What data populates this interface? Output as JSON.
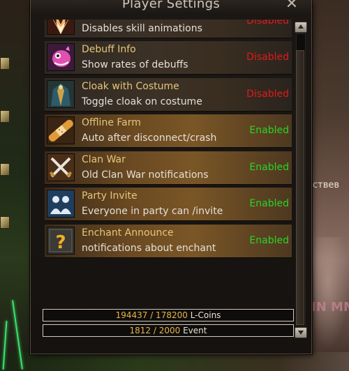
{
  "window": {
    "title": "Player Settings",
    "close_glyph": "✕"
  },
  "settings": [
    {
      "name": "",
      "desc": "Disables skill animations",
      "status": "Disabled",
      "state": "off",
      "icon": "burst-icon"
    },
    {
      "name": "Debuff Info",
      "desc": "Show rates of debuffs",
      "status": "Disabled",
      "state": "off",
      "icon": "pink-creature-icon"
    },
    {
      "name": "Cloak with Costume",
      "desc": "Toggle cloak on costume",
      "status": "Disabled",
      "state": "off",
      "icon": "cloak-icon"
    },
    {
      "name": "Offline Farm",
      "desc": "Auto after disconnect/crash",
      "status": "Enabled",
      "state": "on",
      "icon": "bandage-icon"
    },
    {
      "name": "Clan War",
      "desc": "Old Clan War notifications",
      "status": "Enabled",
      "state": "on",
      "icon": "crossed-swords-icon"
    },
    {
      "name": "Party Invite",
      "desc": "Everyone in party can /invite",
      "status": "Enabled",
      "state": "on",
      "icon": "party-people-icon"
    },
    {
      "name": "Enchant Announce",
      "desc": "notifications about enchant",
      "status": "Enabled",
      "state": "on",
      "icon": "question-mark-icon"
    }
  ],
  "counters": {
    "lcoins": {
      "value": "194437 / 178200",
      "unit": "L-Coins"
    },
    "event": {
      "value": "1812 / 2000",
      "unit": "Event"
    }
  },
  "background": {
    "partial_text": "ствев",
    "partial_pink_text": "IN MM"
  },
  "colors": {
    "enabled": "#28d428",
    "disabled": "#e01a1a",
    "setting_name": "#e6c67a"
  }
}
